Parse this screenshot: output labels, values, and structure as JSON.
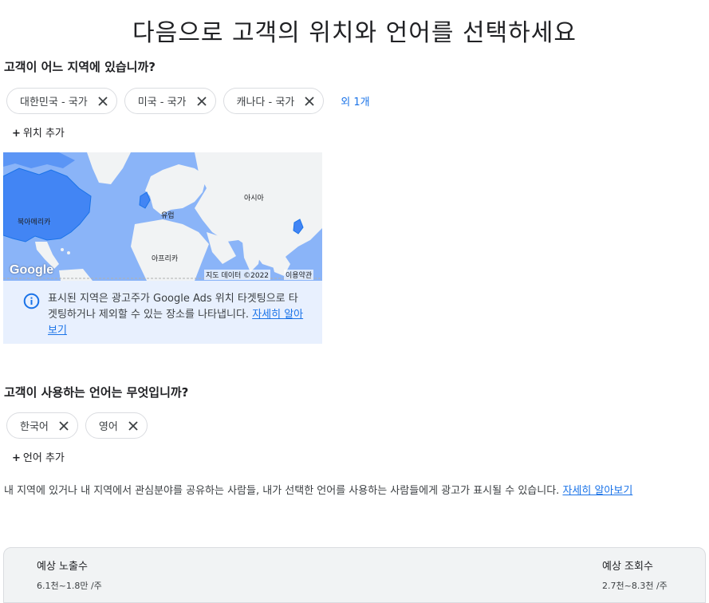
{
  "page": {
    "title": "다음으로 고객의 위치와 언어를 선택하세요"
  },
  "location": {
    "question": "고객이 어느 지역에 있습니까?",
    "chips": [
      {
        "label": "대한민국 - 국가"
      },
      {
        "label": "미국 - 국가"
      },
      {
        "label": "캐나다 - 국가"
      }
    ],
    "more": "외 1개",
    "add_label": "위치 추가"
  },
  "map": {
    "labels": {
      "north_america": "북아메리카",
      "europe": "유럽",
      "asia": "아시아",
      "africa": "아프리카"
    },
    "logo": "Google",
    "data_credit": "지도 데이터 ©2022",
    "terms": "이용약관",
    "colors": {
      "water": "#8ab4f8",
      "land": "#f1f3f4",
      "highlight": "#4285f4"
    }
  },
  "info": {
    "icon": "info-icon",
    "text": "표시된 지역은 광고주가 Google Ads 위치 타겟팅으로 타겟팅하거나 제외할 수 있는 장소를 나타냅니다.",
    "link": "자세히 알아보기"
  },
  "language": {
    "question": "고객이 사용하는 언어는 무엇입니까?",
    "chips": [
      {
        "label": "한국어"
      },
      {
        "label": "영어"
      }
    ],
    "add_label": "언어 추가"
  },
  "disclaimer": {
    "text": "내 지역에 있거나 내 지역에서 관심분야를 공유하는 사람들, 내가 선택한 언어를 사용하는 사람들에게 광고가 표시될 수 있습니다.",
    "link": "자세히 알아보기"
  },
  "estimates": {
    "impressions_label": "예상 노출수",
    "impressions_value": "6.1천~1.8만 /주",
    "views_label": "예상 조회수",
    "views_value": "2.7천~8.3천 /주"
  },
  "colors": {
    "accent": "#1a73e8",
    "chip_border": "#dadce0",
    "info_bg": "#e8f0fe"
  }
}
